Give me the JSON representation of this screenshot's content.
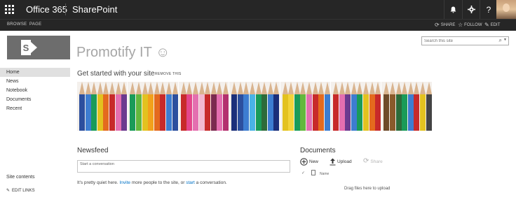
{
  "suite_bar": {
    "brand": "Office 365",
    "app": "SharePoint",
    "icons": [
      "bell-icon",
      "gear-icon",
      "help-icon"
    ],
    "help_label": "?"
  },
  "ribbon": {
    "tabs": [
      "BROWSE",
      "PAGE"
    ],
    "actions": [
      "SHARE",
      "FOLLOW",
      "EDIT"
    ]
  },
  "site": {
    "title": "Promotify IT ☺",
    "search_placeholder": "Search this site"
  },
  "left_nav": {
    "items": [
      "Home",
      "News",
      "Notebook",
      "Documents",
      "Recent"
    ],
    "selected": "Home",
    "site_contents": "Site contents",
    "edit_links": "EDIT LINKS"
  },
  "get_started": {
    "heading": "Get started with your site",
    "remove": "REMOVE THIS",
    "tile_count": 7,
    "tile_palettes": [
      [
        "#2c4f9e",
        "#3d7dd1",
        "#1a9b59",
        "#e3c21f",
        "#e46a1e",
        "#c72a2a",
        "#e46fb0",
        "#6c3a8f"
      ],
      [
        "#1a9b59",
        "#63b83d",
        "#e3c21f",
        "#f2a11b",
        "#e46a1e",
        "#c72a2a",
        "#3d7dd1",
        "#2c4f9e"
      ],
      [
        "#c72a2a",
        "#e4468b",
        "#e46fb0",
        "#f2b8d0",
        "#c72a2a",
        "#7b2a4f",
        "#e46fb0",
        "#b3306e"
      ],
      [
        "#1b2f7a",
        "#2c4f9e",
        "#3d7dd1",
        "#4ab3e6",
        "#1a9b59",
        "#2d6b3a",
        "#3d7dd1",
        "#1b2f7a"
      ],
      [
        "#e3c21f",
        "#f2d43a",
        "#1a9b59",
        "#63b83d",
        "#e46fb0",
        "#c72a2a",
        "#e46a1e",
        "#3d7dd1"
      ],
      [
        "#c72a2a",
        "#e46fb0",
        "#6c3a8f",
        "#3d7dd1",
        "#1a9b59",
        "#e3c21f",
        "#e46a1e",
        "#c72a2a"
      ],
      [
        "#6e4b2a",
        "#8a5a2b",
        "#2d6b3a",
        "#1a9b59",
        "#3d7dd1",
        "#c72a2a",
        "#e3c21f",
        "#444444"
      ]
    ]
  },
  "newsfeed": {
    "title": "Newsfeed",
    "placeholder": "Start a conversation",
    "quiet_prefix": "It's pretty quiet here.",
    "invite_link": "Invite",
    "quiet_middle": "more people to the site, or",
    "start_link": "start",
    "quiet_suffix": "a conversation."
  },
  "documents": {
    "title": "Documents",
    "new_label": "New",
    "upload_label": "Upload",
    "share_label": "Share",
    "column_name": "Name",
    "drag_text": "Drag files here to upload"
  }
}
